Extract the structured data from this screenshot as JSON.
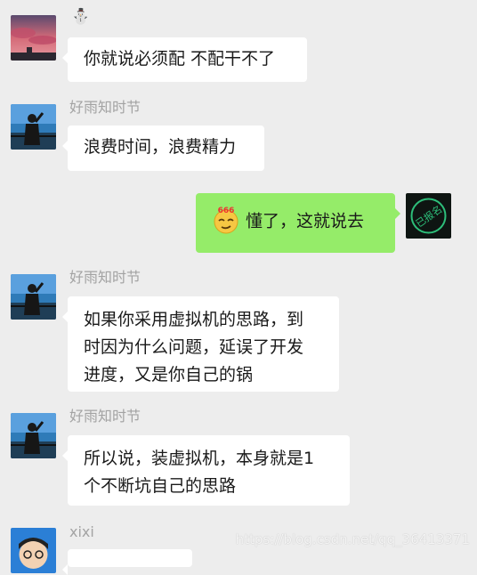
{
  "chat": {
    "messages": [
      {
        "sender": "⛄",
        "avatar": "sunset-landscape-avatar",
        "text_lines": [
          "你就说必须配 不配干不了"
        ]
      },
      {
        "sender": "好雨知时节",
        "avatar": "person-by-lake-avatar",
        "text_lines": [
          "浪费时间，浪费精力"
        ]
      },
      {
        "sender": "self",
        "avatar": "signed-up-stamp-avatar",
        "avatar_text": "已报名",
        "emoji": "666-emoji",
        "emoji_text": "666",
        "text_lines": [
          "懂了，这就说去"
        ]
      },
      {
        "sender": "好雨知时节",
        "avatar": "person-by-lake-avatar",
        "text_lines": [
          "如果你采用虚拟机的思路，到",
          "时因为什么问题，延误了开发",
          "进度，又是你自己的锅"
        ]
      },
      {
        "sender": "好雨知时节",
        "avatar": "person-by-lake-avatar",
        "text_lines": [
          "所以说，装虚拟机，本身就是1",
          "个不断坑自己的思路"
        ]
      },
      {
        "sender": "xixi",
        "avatar": "cartoon-boy-avatar",
        "text_lines": []
      }
    ]
  },
  "watermark": "https://blog.csdn.net/qq_36413371",
  "colors": {
    "background": "#ededed",
    "incoming_bubble": "#ffffff",
    "outgoing_bubble": "#95ec69",
    "sender_name": "#a3a3a3"
  }
}
